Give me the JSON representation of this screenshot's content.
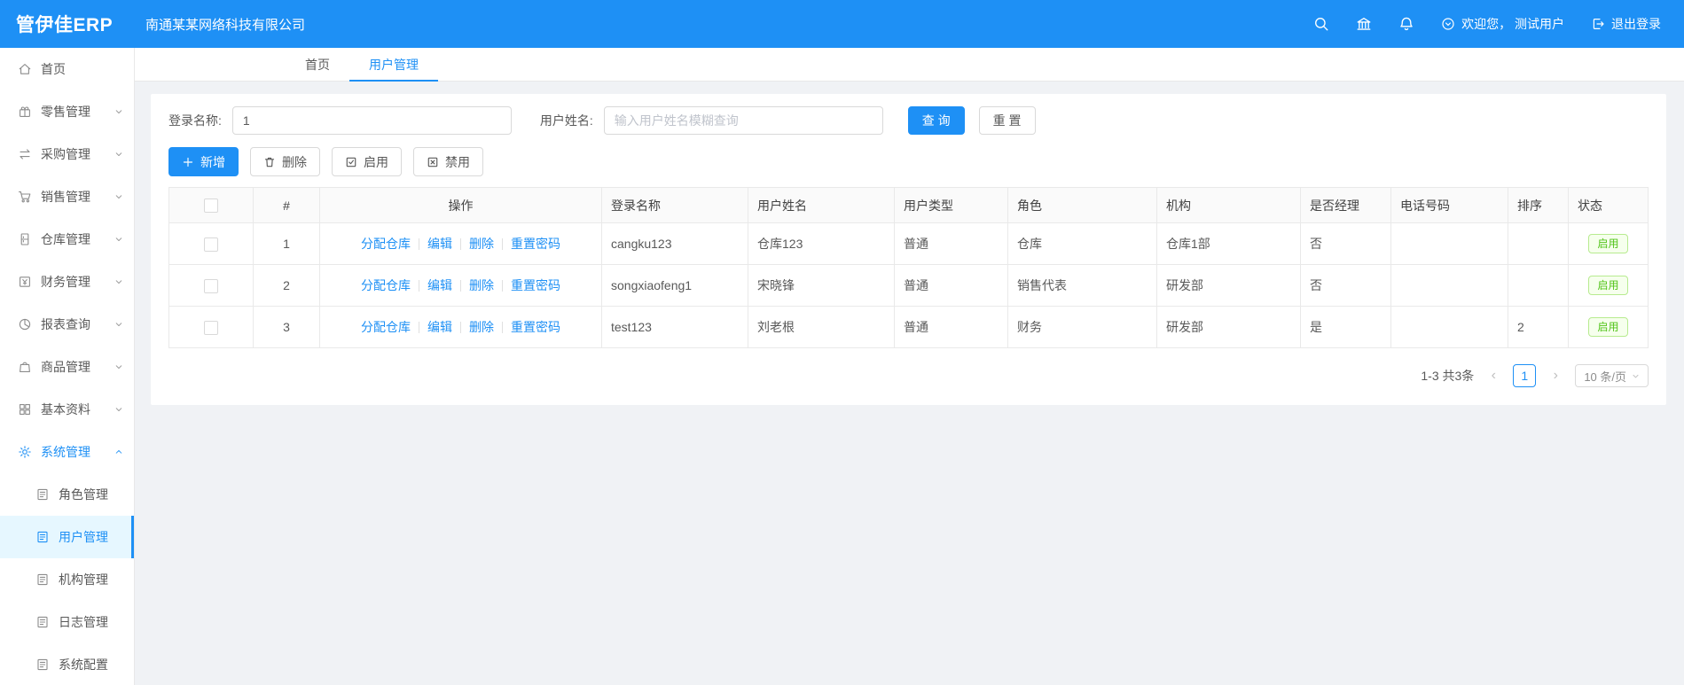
{
  "colors": {
    "primary": "#1e90f5",
    "success_green": "#52c41a"
  },
  "header": {
    "logo": "管伊佳ERP",
    "company": "南通某某网络科技有限公司",
    "welcome": "欢迎您， 测试用户",
    "logout": "退出登录"
  },
  "sidebar": {
    "items": [
      {
        "label": "首页",
        "icon": "home-icon"
      },
      {
        "label": "零售管理",
        "icon": "retail-icon"
      },
      {
        "label": "采购管理",
        "icon": "purchase-icon"
      },
      {
        "label": "销售管理",
        "icon": "sales-icon"
      },
      {
        "label": "仓库管理",
        "icon": "warehouse-icon"
      },
      {
        "label": "财务管理",
        "icon": "finance-icon"
      },
      {
        "label": "报表查询",
        "icon": "report-icon"
      },
      {
        "label": "商品管理",
        "icon": "product-icon"
      },
      {
        "label": "基本资料",
        "icon": "basic-data-icon"
      },
      {
        "label": "系统管理",
        "icon": "system-icon",
        "expanded": true,
        "active": true
      }
    ],
    "system_children": [
      {
        "label": "角色管理"
      },
      {
        "label": "用户管理",
        "active": true
      },
      {
        "label": "机构管理"
      },
      {
        "label": "日志管理"
      },
      {
        "label": "系统配置"
      }
    ]
  },
  "tabs": [
    {
      "label": "首页",
      "active": false
    },
    {
      "label": "用户管理",
      "active": true
    }
  ],
  "filters": {
    "login_label": "登录名称:",
    "login_value": "1",
    "name_label": "用户姓名:",
    "name_placeholder": "输入用户姓名模糊查询",
    "search_btn": "查 询",
    "reset_btn": "重 置"
  },
  "toolbar": {
    "add": "新增",
    "delete": "删除",
    "enable": "启用",
    "disable": "禁用"
  },
  "table": {
    "headers": [
      "#",
      "操作",
      "登录名称",
      "用户姓名",
      "用户类型",
      "角色",
      "机构",
      "是否经理",
      "电话号码",
      "排序",
      "状态"
    ],
    "op_links": [
      "分配仓库",
      "编辑",
      "删除",
      "重置密码"
    ],
    "rows": [
      {
        "index": "1",
        "login": "cangku123",
        "name": "仓库123",
        "type": "普通",
        "role": "仓库",
        "org": "仓库1部",
        "manager": "否",
        "phone": "",
        "sort": "",
        "status": "启用"
      },
      {
        "index": "2",
        "login": "songxiaofeng1",
        "name": "宋晓锋",
        "type": "普通",
        "role": "销售代表",
        "org": "研发部",
        "manager": "否",
        "phone": "",
        "sort": "",
        "status": "启用"
      },
      {
        "index": "3",
        "login": "test123",
        "name": "刘老根",
        "type": "普通",
        "role": "财务",
        "org": "研发部",
        "manager": "是",
        "phone": "",
        "sort": "2",
        "status": "启用"
      }
    ]
  },
  "pagination": {
    "total": "1-3 共3条",
    "current": "1",
    "size": "10 条/页"
  }
}
